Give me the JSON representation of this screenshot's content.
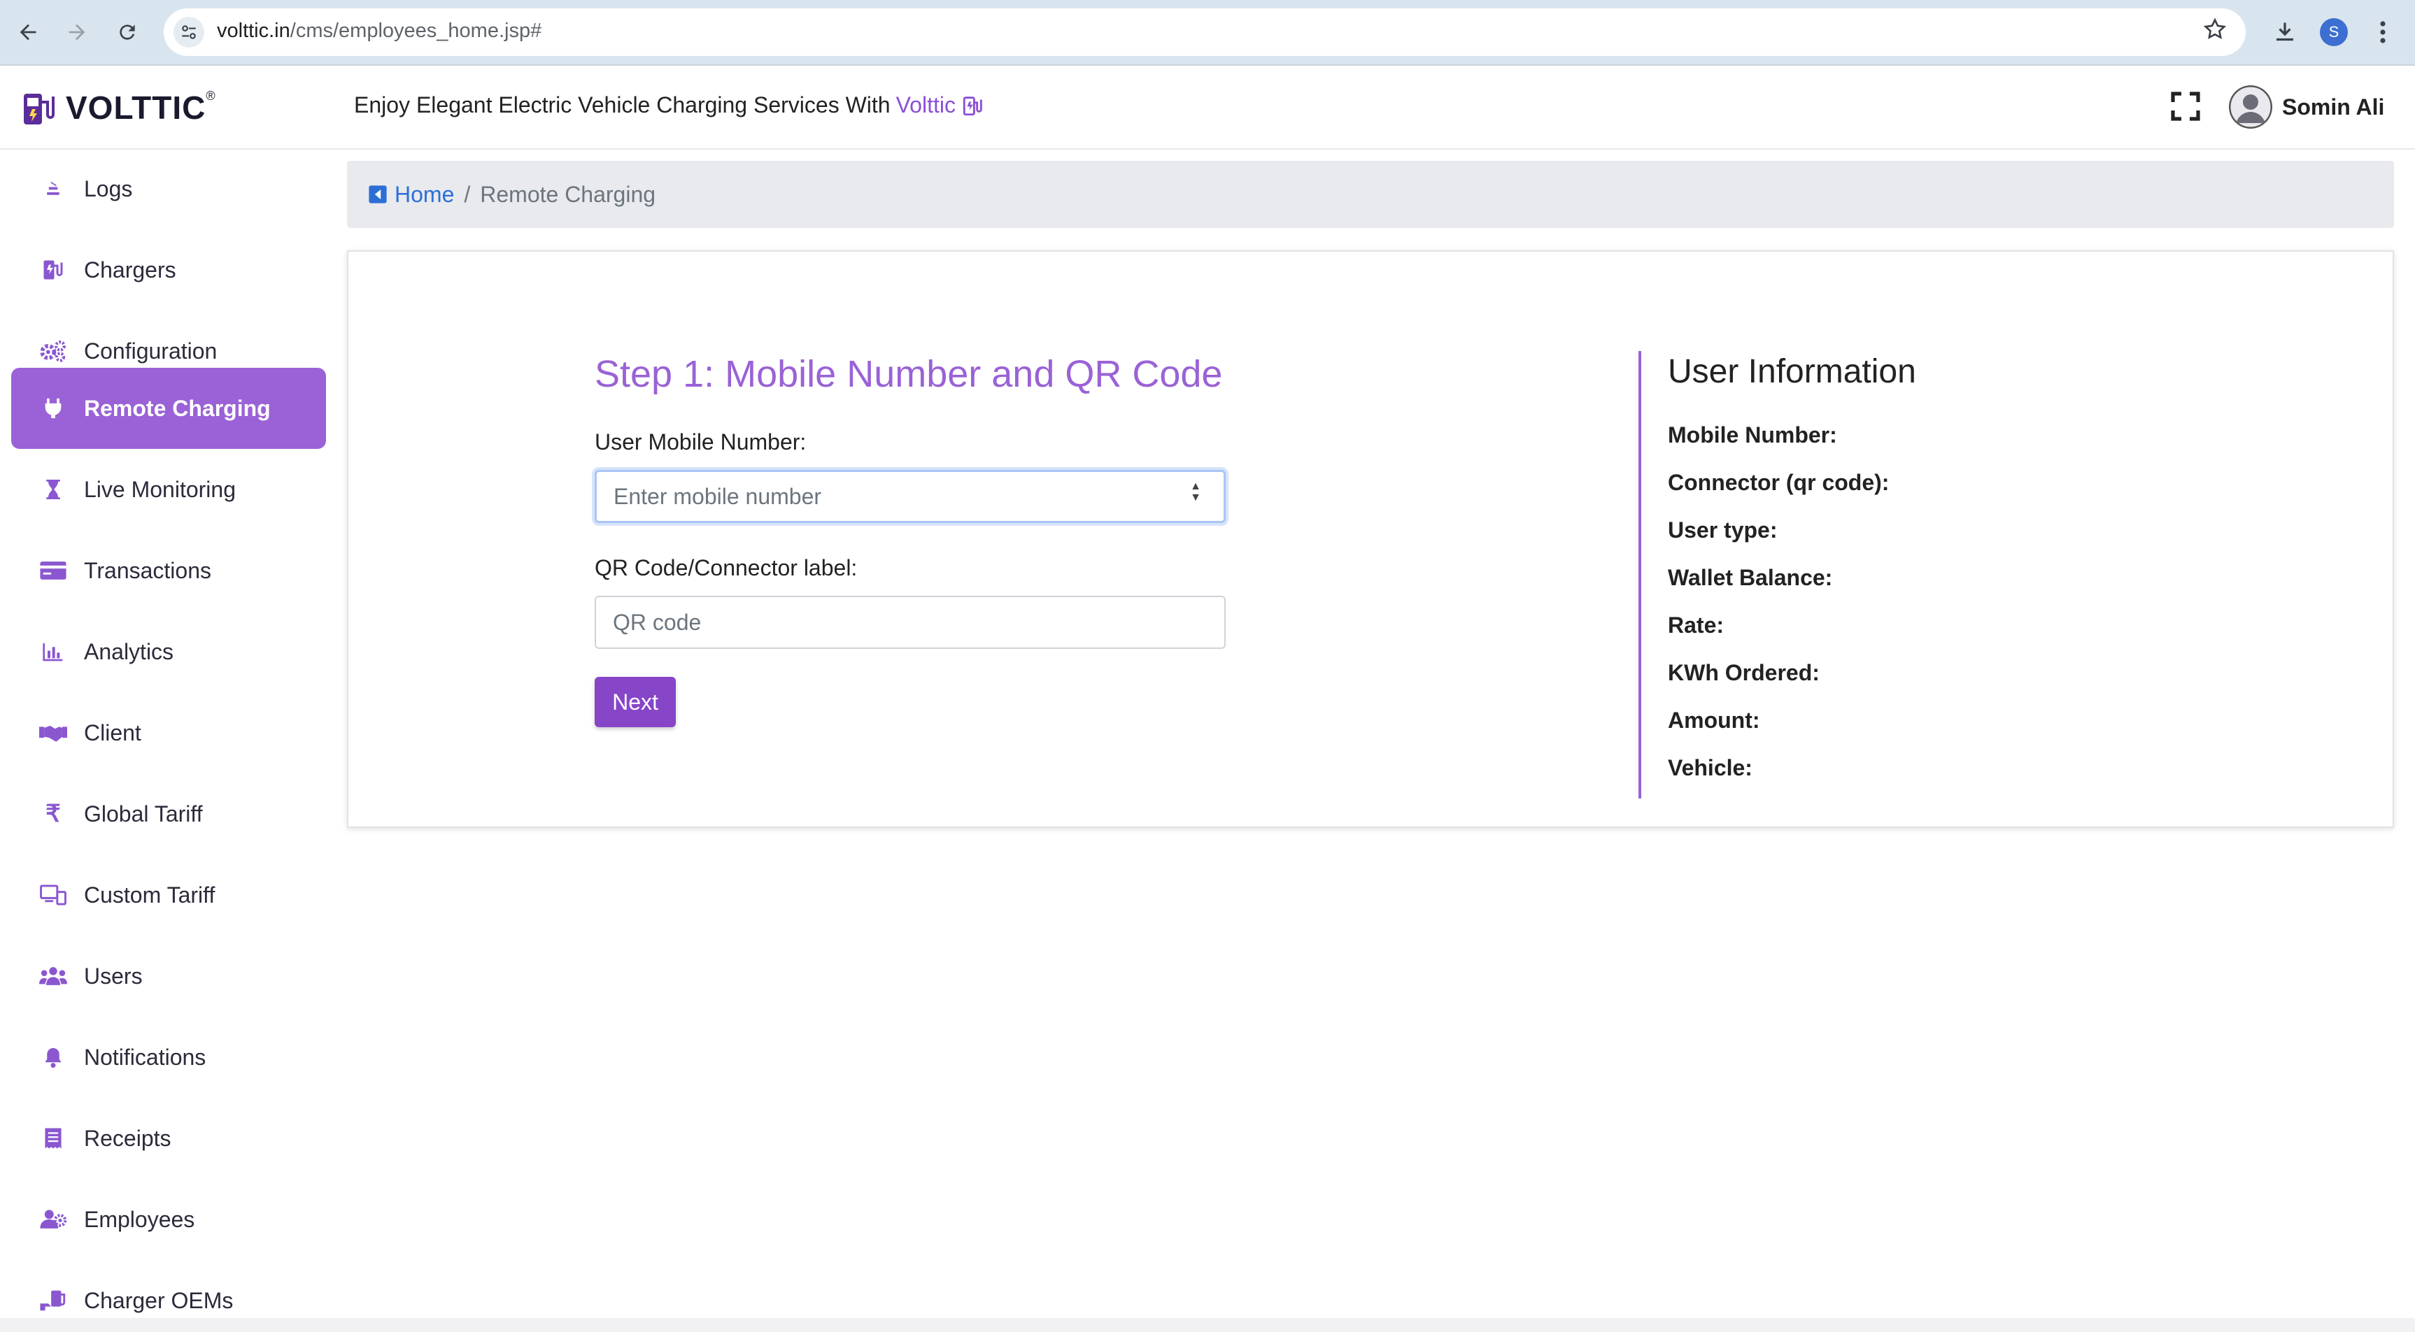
{
  "browser": {
    "url_host": "volttic.in",
    "url_path": "/cms/employees_home.jsp#",
    "profile_initial": "S",
    "icons": [
      "back-arrow-icon",
      "forward-arrow-icon",
      "reload-icon",
      "site-settings-icon",
      "bookmark-star-icon",
      "download-icon",
      "kebab-menu-icon"
    ]
  },
  "header": {
    "logo_text": "VOLTTIC",
    "logo_reg": "®",
    "tagline": "Enjoy Elegant Electric Vehicle Charging Services With",
    "tagline_brand": "Volttic",
    "user_name": "Somin Ali"
  },
  "sidebar": {
    "items": [
      {
        "label": "Logs",
        "icon": "logs-icon"
      },
      {
        "label": "Chargers",
        "icon": "charger-icon"
      },
      {
        "label": "Configuration",
        "icon": "gears-icon"
      },
      {
        "label": "Remote Charging",
        "icon": "plug-icon",
        "active": true
      },
      {
        "label": "Live Monitoring",
        "icon": "hourglass-icon"
      },
      {
        "label": "Transactions",
        "icon": "credit-card-icon"
      },
      {
        "label": "Analytics",
        "icon": "bar-chart-icon"
      },
      {
        "label": "Client",
        "icon": "handshake-icon"
      },
      {
        "label": "Global Tariff",
        "icon": "rupee-icon"
      },
      {
        "label": "Custom Tariff",
        "icon": "custom-tariff-icon"
      },
      {
        "label": "Users",
        "icon": "users-icon"
      },
      {
        "label": "Notifications",
        "icon": "bell-icon"
      },
      {
        "label": "Receipts",
        "icon": "receipt-icon"
      },
      {
        "label": "Employees",
        "icon": "employees-icon"
      },
      {
        "label": "Charger OEMs",
        "icon": "charger-oems-icon"
      }
    ]
  },
  "breadcrumb": {
    "home": "Home",
    "separator": "/",
    "current": "Remote Charging"
  },
  "form": {
    "title": "Step 1: Mobile Number and QR Code",
    "mobile_label": "User Mobile Number:",
    "mobile_placeholder": "Enter mobile number",
    "qr_label": "QR Code/Connector label:",
    "qr_placeholder": "QR code",
    "next_label": "Next"
  },
  "user_info": {
    "title": "User Information",
    "fields": [
      "Mobile Number:",
      "Connector (qr code):",
      "User type:",
      "Wallet Balance:",
      "Rate:",
      "KWh Ordered:",
      "Amount:",
      "Vehicle:"
    ]
  },
  "colors": {
    "accent": "#9a62d6",
    "button": "#8745c8",
    "link": "#2b6fd6",
    "browser_bar": "#d9e5ee"
  }
}
